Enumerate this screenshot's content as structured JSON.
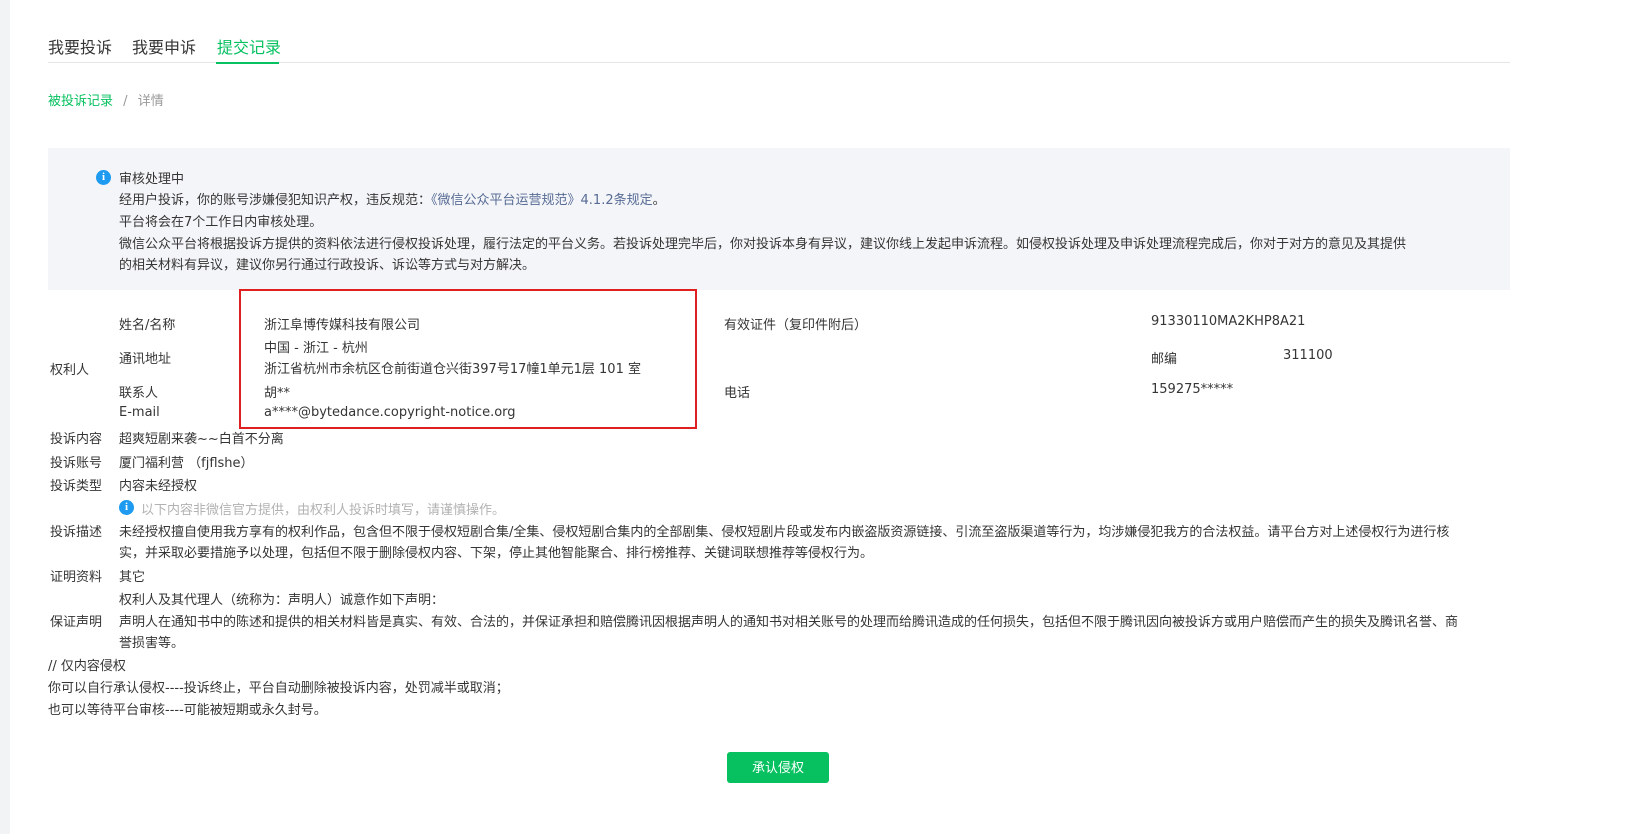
{
  "tabs": [
    {
      "label": "我要投诉"
    },
    {
      "label": "我要申诉"
    },
    {
      "label": "提交记录"
    }
  ],
  "breadcrumb": {
    "parent": "被投诉记录",
    "separator": "/",
    "current": "详情"
  },
  "notice": {
    "title": "审核处理中",
    "line1_prefix": "经用户投诉，你的账号涉嫌侵犯知识产权，违反规范：",
    "line1_link": "《微信公众平台运营规范》4.1.2条规定",
    "line1_suffix": "。",
    "line2": "平台将会在7个工作日内审核处理。",
    "line3": "微信公众平台将根据投诉方提供的资料依法进行侵权投诉处理，履行法定的平台义务。若投诉处理完毕后，你对投诉本身有异议，建议你线上发起申诉流程。如侵权投诉处理及申诉处理流程完成后，你对于对方的意见及其提供",
    "line4": "的相关材料有异议，建议你另行通过行政投诉、诉讼等方式与对方解决。"
  },
  "rights_holder": {
    "section_label": "权利人",
    "name_label": "姓名/名称",
    "name_value": "浙江阜博传媒科技有限公司",
    "address_label": "通讯地址",
    "address_region": "中国 - 浙江 - 杭州",
    "address_detail": "浙江省杭州市余杭区仓前街道仓兴街397号17幢1单元1层 101 室",
    "contact_label": "联系人",
    "contact_value": "胡**",
    "email_label": "E-mail",
    "email_value": "a****@bytedance.copyright-notice.org",
    "cert_label": "有效证件（复印件附后）",
    "cert_value": "91330110MA2KHP8A21",
    "zip_label": "邮编",
    "zip_value": "311100",
    "phone_label": "电话",
    "phone_value": "159275*****"
  },
  "complaint": {
    "content_label": "投诉内容",
    "content_value": "超爽短剧来袭~~白首不分离",
    "account_label": "投诉账号",
    "account_value": "厦门福利营 （fjflshe）",
    "type_label": "投诉类型",
    "type_value": "内容未经授权",
    "hint": "以下内容非微信官方提供，由权利人投诉时填写，请谨慎操作。",
    "desc_label": "投诉描述",
    "desc_line1": "未经授权擅自使用我方享有的权利作品，包含但不限于侵权短剧合集/全集、侵权短剧合集内的全部剧集、侵权短剧片段或发布内嵌盗版资源链接、引流至盗版渠道等行为，均涉嫌侵犯我方的合法权益。请平台方对上述侵权行为进行核",
    "desc_line2": "实，并采取必要措施予以处理，包括但不限于删除侵权内容、下架，停止其他智能聚合、排行榜推荐、关键词联想推荐等侵权行为。",
    "proof_label": "证明资料",
    "proof_value": "其它",
    "guarantee_label": "保证声明",
    "guarantee_line1": "权利人及其代理人（统称为：声明人）诚意作如下声明：",
    "guarantee_line2": "声明人在通知书中的陈述和提供的相关材料皆是真实、有效、合法的，并保证承担和赔偿腾讯因根据声明人的通知书对相关账号的处理而给腾讯造成的任何损失，包括但不限于腾讯因向被投诉方或用户赔偿而产生的损失及腾讯名誉、商",
    "guarantee_line3": "誉损害等。"
  },
  "footnote": {
    "line1": "// 仅内容侵权",
    "line2": "你可以自行承认侵权----投诉终止，平台自动删除被投诉内容，处罚减半或取消；",
    "line3": "也可以等待平台审核----可能被短期或永久封号。"
  },
  "actions": {
    "acknowledge_label": "承认侵权"
  },
  "colors": {
    "accent": "#07c160",
    "link": "#576b95",
    "highlight_box": "#e02020",
    "info": "#1e9bf0"
  }
}
